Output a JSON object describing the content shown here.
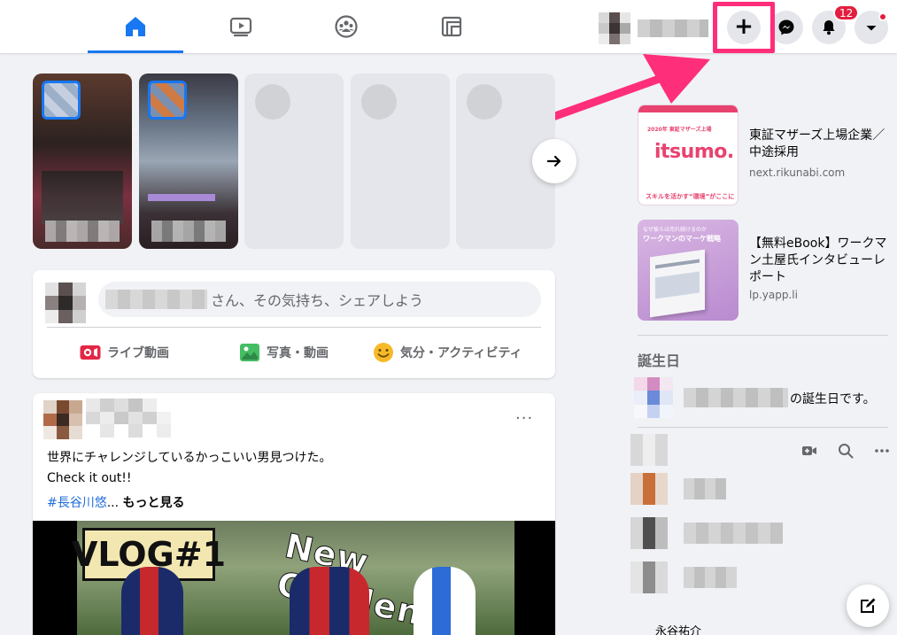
{
  "header": {
    "nav_tabs": [
      {
        "id": "home",
        "active": true
      },
      {
        "id": "watch",
        "active": false
      },
      {
        "id": "groups",
        "active": false
      },
      {
        "id": "gaming",
        "active": false
      }
    ],
    "create_button_symbol": "+",
    "notifications_count": "12",
    "accent_color": "#1877f2",
    "highlight_color": "#ff2e7a"
  },
  "stories": {
    "next_arrow_icon": "arrow-right-icon"
  },
  "composer": {
    "prompt": "さん、その気持ち、シェアしよう",
    "actions": [
      {
        "label": "ライブ動画",
        "icon": "live-video-icon"
      },
      {
        "label": "写真・動画",
        "icon": "photo-icon"
      },
      {
        "label": "気分・アクティビティ",
        "icon": "feeling-icon"
      }
    ]
  },
  "post": {
    "more_symbol": "···",
    "lines": [
      "世界にチャレンジしているかっこいい男見つけた。",
      "Check it out!!"
    ],
    "hashtag": "#長谷川悠",
    "ellipsis": "...",
    "see_more": "もっと見る",
    "video": {
      "badge_text": "VLOG#1",
      "overlay_text": "New Challen"
    }
  },
  "sidebar": {
    "ads": [
      {
        "title": "東証マザーズ上場企業／中途採用",
        "domain": "next.rikunabi.com",
        "thumb_brand": "itsumo.",
        "thumb_top": "2020年 東証マザーズ上場",
        "thumb_bottom": "スキルを活かす“環境”がここに"
      },
      {
        "title": "【無料eBook】ワークマン土屋氏インタビューレポート",
        "domain": "lp.yapp.li",
        "thumb_top": "なぜ彼らは売れ続けるのか",
        "thumb_headline": "ワークマンのマーケ戦略"
      }
    ],
    "birthdays": {
      "title": "誕生日",
      "text": "の誕生日です。"
    },
    "contacts_partial_name": "永谷祐介"
  }
}
